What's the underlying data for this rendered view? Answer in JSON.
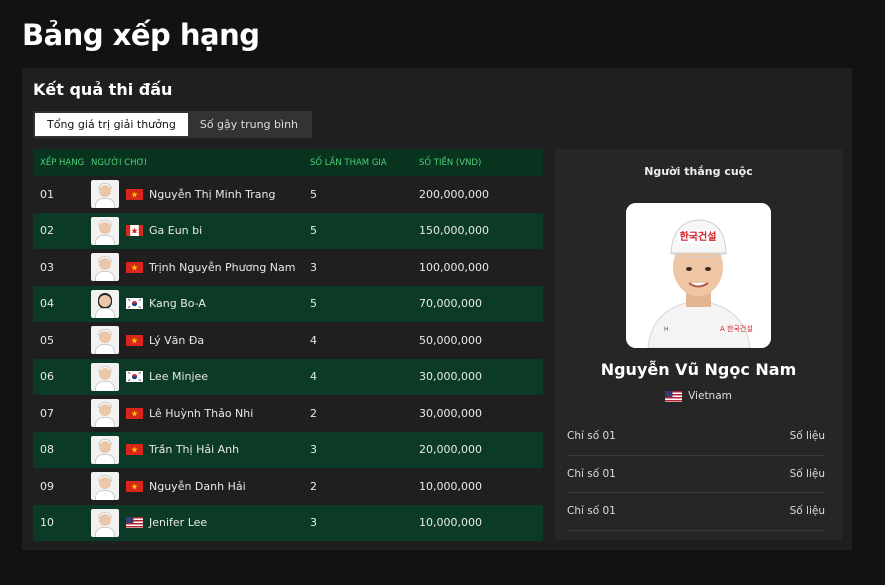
{
  "page": {
    "title": "Bảng xếp hạng"
  },
  "section": {
    "title": "Kết quả thi đấu"
  },
  "tabs": [
    {
      "label": "Tổng giá trị giải thưởng",
      "active": true
    },
    {
      "label": "Số gậy trung bình",
      "active": false
    }
  ],
  "table": {
    "headers": {
      "rank": "Xếp hạng",
      "player": "Người chơi",
      "times": "Số lần tham gia",
      "money": "Số tiền (VND)"
    },
    "rows": [
      {
        "rank": "01",
        "name": "Nguyễn Thị Minh Trang",
        "flag": "vn",
        "times": "5",
        "money": "200,000,000"
      },
      {
        "rank": "02",
        "name": "Ga Eun bi",
        "flag": "ca",
        "times": "5",
        "money": "150,000,000"
      },
      {
        "rank": "03",
        "name": "Trịnh Nguyễn Phương Nam",
        "flag": "vn",
        "times": "3",
        "money": "100,000,000"
      },
      {
        "rank": "04",
        "name": "Kang Bo-A",
        "flag": "kr",
        "times": "5",
        "money": "70,000,000"
      },
      {
        "rank": "05",
        "name": "Lý Văn Đa",
        "flag": "vn",
        "times": "4",
        "money": "50,000,000"
      },
      {
        "rank": "06",
        "name": "Lee Minjee",
        "flag": "kr",
        "times": "4",
        "money": "30,000,000"
      },
      {
        "rank": "07",
        "name": "Lê Huỳnh Thảo Nhi",
        "flag": "vn",
        "times": "2",
        "money": "30,000,000"
      },
      {
        "rank": "08",
        "name": "Trần Thị Hải Anh",
        "flag": "vn",
        "times": "3",
        "money": "20,000,000"
      },
      {
        "rank": "09",
        "name": "Nguyễn Danh Hải",
        "flag": "vn",
        "times": "2",
        "money": "10,000,000"
      },
      {
        "rank": "10",
        "name": "Jenifer Lee",
        "flag": "us",
        "times": "3",
        "money": "10,000,000"
      }
    ]
  },
  "winner": {
    "title": "Người thắng cuộc",
    "name": "Nguyễn Vũ Ngọc Nam",
    "country": "Vietnam",
    "flag": "us",
    "stats": [
      {
        "label": "Chỉ số 01",
        "value": "Số liệu"
      },
      {
        "label": "Chỉ số 01",
        "value": "Số liệu"
      },
      {
        "label": "Chỉ số 01",
        "value": "Số liệu"
      }
    ]
  },
  "colors": {
    "accent": "#4fd07a",
    "row_alt": "#0b3b26",
    "header_bg": "#08331f"
  }
}
